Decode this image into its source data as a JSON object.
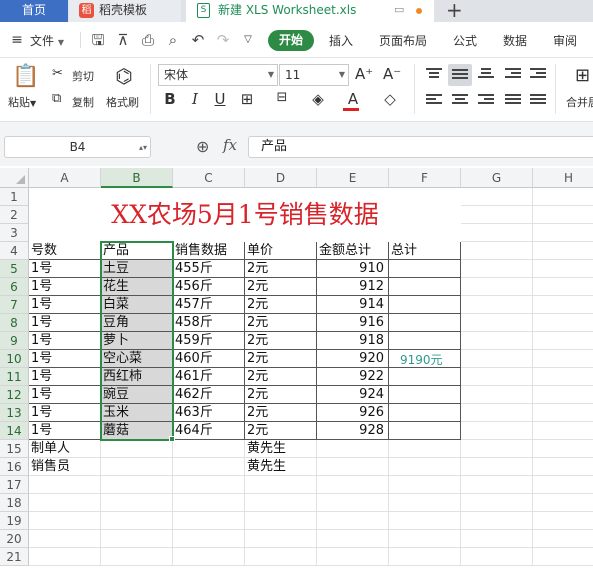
{
  "tabs": {
    "home": "首页",
    "template": "稻壳模板",
    "template_icon": "稻",
    "doc": "新建 XLS Worksheet.xls",
    "doc_icon": "S",
    "add": "+"
  },
  "menubar": {
    "file": "文件",
    "items": [
      "开始",
      "插入",
      "页面布局",
      "公式",
      "数据",
      "审阅"
    ]
  },
  "ribbon": {
    "paste": "粘贴",
    "cut": "剪切",
    "copy": "复制",
    "format_painter": "格式刷",
    "font_name": "宋体",
    "font_size": "11",
    "bold": "B",
    "italic": "I",
    "underline": "U",
    "font_color_glyph": "A",
    "grow_font": "A⁺",
    "shrink_font": "A⁻",
    "merge_center": "合并居中"
  },
  "formula_bar": {
    "name_box": "B4",
    "fx": "fx",
    "content": "产品"
  },
  "sheet": {
    "columns": [
      "A",
      "B",
      "C",
      "D",
      "E",
      "F",
      "G",
      "H"
    ],
    "selected_column": "B",
    "rows": [
      "1",
      "2",
      "3",
      "4",
      "5",
      "6",
      "7",
      "8",
      "9",
      "10",
      "11",
      "12",
      "13",
      "14",
      "15",
      "16",
      "17",
      "18",
      "19",
      "20",
      "21"
    ],
    "selected_rows": [
      "5",
      "6",
      "7",
      "8",
      "9",
      "10",
      "11",
      "12",
      "13",
      "14"
    ],
    "title": "XX农场5月1号销售数据",
    "headers": [
      "号数",
      "产品",
      "销售数据",
      "单价",
      "金额总计",
      "总计"
    ],
    "data_rows": [
      [
        "1号",
        "土豆",
        "455斤",
        "2元",
        "910"
      ],
      [
        "1号",
        "花生",
        "456斤",
        "2元",
        "912"
      ],
      [
        "1号",
        "白菜",
        "457斤",
        "2元",
        "914"
      ],
      [
        "1号",
        "豆角",
        "458斤",
        "2元",
        "916"
      ],
      [
        "1号",
        "萝卜",
        "459斤",
        "2元",
        "918"
      ],
      [
        "1号",
        "空心菜",
        "460斤",
        "2元",
        "920"
      ],
      [
        "1号",
        "西红柿",
        "461斤",
        "2元",
        "922"
      ],
      [
        "1号",
        "豌豆",
        "462斤",
        "2元",
        "924"
      ],
      [
        "1号",
        "玉米",
        "463斤",
        "2元",
        "926"
      ],
      [
        "1号",
        "蘑菇",
        "464斤",
        "2元",
        "928"
      ]
    ],
    "total": "9190元",
    "maker_label": "制单人",
    "seller_label": "销售员",
    "maker_name": "黄先生",
    "seller_name": "黄先生"
  },
  "colors": {
    "accent": "#2e8b45",
    "title": "#d7242a",
    "home_tab": "#3d6fc4",
    "total": "#2f9a8e"
  }
}
